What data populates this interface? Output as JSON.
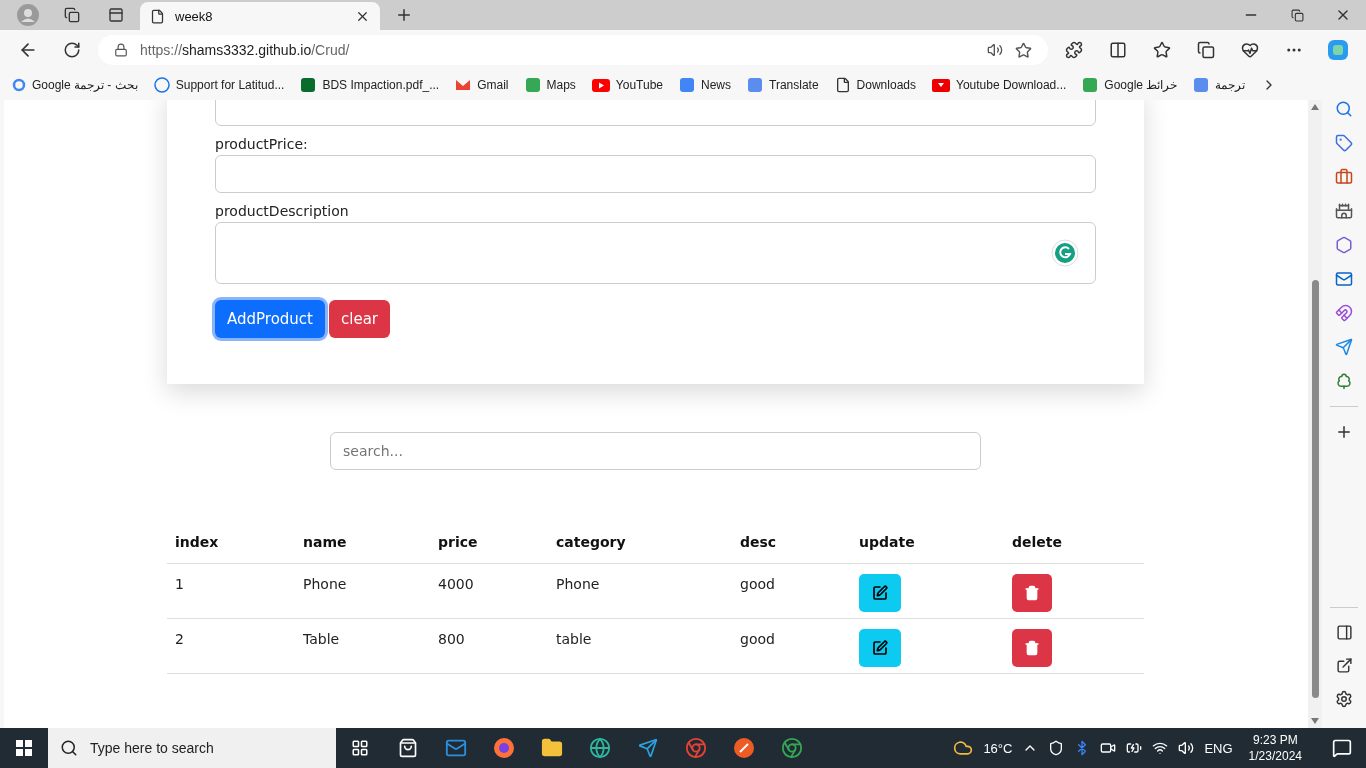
{
  "browser": {
    "tabs": [
      {
        "title": "week8",
        "selected": true
      }
    ],
    "url": {
      "scheme": "https://",
      "host": "shams3332.github.io",
      "path": "/Crud/"
    },
    "bookmarks": [
      {
        "label": "Google بحث - ترجمة"
      },
      {
        "label": "Support for Latitud..."
      },
      {
        "label": "BDS Impaction.pdf_..."
      },
      {
        "label": "Gmail"
      },
      {
        "label": "Maps"
      },
      {
        "label": "YouTube"
      },
      {
        "label": "News"
      },
      {
        "label": "Translate"
      },
      {
        "label": "Downloads"
      },
      {
        "label": "Youtube Download..."
      },
      {
        "label": "Google خرائط"
      },
      {
        "label": "ترجمة"
      }
    ]
  },
  "page": {
    "fields": [
      {
        "kind": "input"
      },
      {
        "kind": "input",
        "label": "productPrice:"
      },
      {
        "kind": "textarea",
        "label": "productDescription"
      }
    ],
    "buttons": [
      {
        "label": "AddProduct",
        "kind": "primary",
        "focused": true
      },
      {
        "label": "clear",
        "kind": "danger",
        "focused": false
      }
    ],
    "search": {
      "placeholder": "search..."
    },
    "table": {
      "columns": [
        "index",
        "name",
        "price",
        "category",
        "desc",
        "update",
        "delete"
      ],
      "rows": [
        {
          "index": "1",
          "name": "Phone",
          "price": "4000",
          "category": "Phone",
          "desc": "good"
        },
        {
          "index": "2",
          "name": "Table",
          "price": "800",
          "category": "table",
          "desc": "good"
        }
      ]
    }
  },
  "taskbar": {
    "search_placeholder": "Type here to search",
    "temperature": "16°C",
    "language": "ENG",
    "time": "9:23 PM",
    "date": "1/23/2024"
  }
}
